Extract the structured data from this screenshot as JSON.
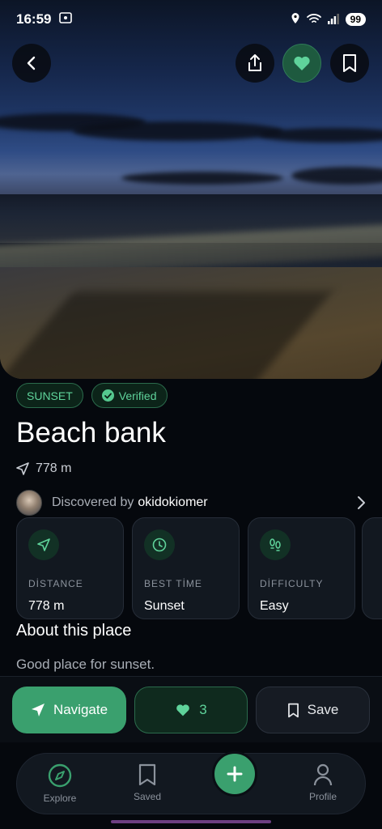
{
  "status_bar": {
    "time": "16:59",
    "battery": "99"
  },
  "place": {
    "tags": {
      "category": "SUNSET",
      "verified": "Verified"
    },
    "title": "Beach bank",
    "distance": "778 m",
    "discovered_prefix": "Discovered by",
    "discovered_user": "okidokiomer"
  },
  "stats": [
    {
      "label": "DİSTANCE",
      "value": "778 m",
      "icon": "navigation-arrow-icon"
    },
    {
      "label": "BEST TİME",
      "value": "Sunset",
      "icon": "clock-icon"
    },
    {
      "label": "DİFFICULTY",
      "value": "Easy",
      "icon": "footprints-icon"
    }
  ],
  "about": {
    "heading": "About this place",
    "description": "Good place for sunset."
  },
  "actions": {
    "navigate": "Navigate",
    "likes": "3",
    "save": "Save"
  },
  "bottom_nav": {
    "explore": "Explore",
    "saved": "Saved",
    "profile": "Profile"
  },
  "colors": {
    "accent": "#3aa06e",
    "accent_text": "#5fd39b",
    "background": "#05080d"
  }
}
